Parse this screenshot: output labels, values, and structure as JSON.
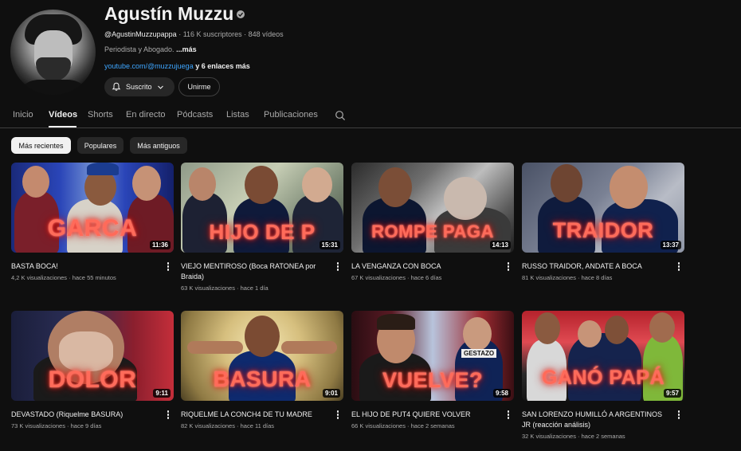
{
  "channel": {
    "name": "Agustín Muzzu",
    "handle": "@AgustinMuzzupappa",
    "subscribers": "116 K suscriptores",
    "video_count": "848 vídeos",
    "separator": " · ",
    "description": "Periodista y Abogado.",
    "more_label": "...más",
    "link": "youtube.com/@muzzujuega",
    "extra_links": " y 6 enlaces más",
    "subscribed_label": "Suscrito",
    "join_label": "Unirme"
  },
  "tabs": [
    "Inicio",
    "Vídeos",
    "Shorts",
    "En directo",
    "Pódcasts",
    "Listas",
    "Publicaciones"
  ],
  "active_tab": "Vídeos",
  "chips": [
    "Más recientes",
    "Populares",
    "Más antiguos"
  ],
  "videos": [
    {
      "title": "BASTA BOCA!",
      "views": "4,2 K visualizaciones",
      "age": "hace 55 minutos",
      "duration": "11:36",
      "thumb_text": "GARCA"
    },
    {
      "title": "VIEJO MENTIROSO (Boca RATONEA por Braida)",
      "views": "63 K visualizaciones",
      "age": "hace 1 día",
      "duration": "15:31",
      "thumb_text": "HIJO DE P"
    },
    {
      "title": "LA VENGANZA CON BOCA",
      "views": "67 K visualizaciones",
      "age": "hace 6 días",
      "duration": "14:13",
      "thumb_text": "ROMPE PAGA"
    },
    {
      "title": "RUSSO TRAIDOR, ANDATE A BOCA",
      "views": "81 K visualizaciones",
      "age": "hace 8 días",
      "duration": "13:37",
      "thumb_text": "TRAIDOR"
    },
    {
      "title": "DEVASTADO (Riquelme BASURA)",
      "views": "73 K visualizaciones",
      "age": "hace 9 días",
      "duration": "9:11",
      "thumb_text": "DOLOR"
    },
    {
      "title": "RIQUELME LA CONCH4 DE TU MADRE",
      "views": "82 K visualizaciones",
      "age": "hace 11 días",
      "duration": "9:01",
      "thumb_text": "BASURA"
    },
    {
      "title": "EL HIJO DE PUT4 QUIERE VOLVER",
      "views": "66 K visualizaciones",
      "age": "hace 2 semanas",
      "duration": "9:58",
      "thumb_text": "VUELVE?",
      "badge": "GESTAZO"
    },
    {
      "title": "SAN LORENZO HUMILLÓ A ARGENTINOS JR (reacción análisis)",
      "views": "32 K visualizaciones",
      "age": "hace 2 semanas",
      "duration": "9:57",
      "thumb_text": "GANÓ PAPÁ"
    }
  ],
  "colors": {
    "background": "#0f0f0f",
    "link": "#3ea6ff",
    "thumb_text": "#ff6b5a"
  },
  "icons": [
    "verified-icon",
    "bell-icon",
    "chevron-down-icon",
    "search-icon",
    "more-vert-icon"
  ]
}
